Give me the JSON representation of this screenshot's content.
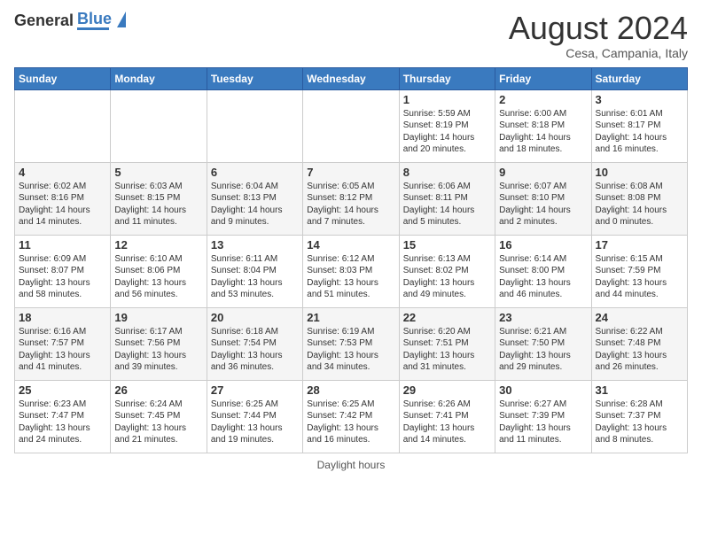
{
  "logo": {
    "general": "General",
    "blue": "Blue"
  },
  "title": "August 2024",
  "subtitle": "Cesa, Campania, Italy",
  "days_header": [
    "Sunday",
    "Monday",
    "Tuesday",
    "Wednesday",
    "Thursday",
    "Friday",
    "Saturday"
  ],
  "weeks": [
    [
      {
        "day": "",
        "info": ""
      },
      {
        "day": "",
        "info": ""
      },
      {
        "day": "",
        "info": ""
      },
      {
        "day": "",
        "info": ""
      },
      {
        "day": "1",
        "info": "Sunrise: 5:59 AM\nSunset: 8:19 PM\nDaylight: 14 hours\nand 20 minutes."
      },
      {
        "day": "2",
        "info": "Sunrise: 6:00 AM\nSunset: 8:18 PM\nDaylight: 14 hours\nand 18 minutes."
      },
      {
        "day": "3",
        "info": "Sunrise: 6:01 AM\nSunset: 8:17 PM\nDaylight: 14 hours\nand 16 minutes."
      }
    ],
    [
      {
        "day": "4",
        "info": "Sunrise: 6:02 AM\nSunset: 8:16 PM\nDaylight: 14 hours\nand 14 minutes."
      },
      {
        "day": "5",
        "info": "Sunrise: 6:03 AM\nSunset: 8:15 PM\nDaylight: 14 hours\nand 11 minutes."
      },
      {
        "day": "6",
        "info": "Sunrise: 6:04 AM\nSunset: 8:13 PM\nDaylight: 14 hours\nand 9 minutes."
      },
      {
        "day": "7",
        "info": "Sunrise: 6:05 AM\nSunset: 8:12 PM\nDaylight: 14 hours\nand 7 minutes."
      },
      {
        "day": "8",
        "info": "Sunrise: 6:06 AM\nSunset: 8:11 PM\nDaylight: 14 hours\nand 5 minutes."
      },
      {
        "day": "9",
        "info": "Sunrise: 6:07 AM\nSunset: 8:10 PM\nDaylight: 14 hours\nand 2 minutes."
      },
      {
        "day": "10",
        "info": "Sunrise: 6:08 AM\nSunset: 8:08 PM\nDaylight: 14 hours\nand 0 minutes."
      }
    ],
    [
      {
        "day": "11",
        "info": "Sunrise: 6:09 AM\nSunset: 8:07 PM\nDaylight: 13 hours\nand 58 minutes."
      },
      {
        "day": "12",
        "info": "Sunrise: 6:10 AM\nSunset: 8:06 PM\nDaylight: 13 hours\nand 56 minutes."
      },
      {
        "day": "13",
        "info": "Sunrise: 6:11 AM\nSunset: 8:04 PM\nDaylight: 13 hours\nand 53 minutes."
      },
      {
        "day": "14",
        "info": "Sunrise: 6:12 AM\nSunset: 8:03 PM\nDaylight: 13 hours\nand 51 minutes."
      },
      {
        "day": "15",
        "info": "Sunrise: 6:13 AM\nSunset: 8:02 PM\nDaylight: 13 hours\nand 49 minutes."
      },
      {
        "day": "16",
        "info": "Sunrise: 6:14 AM\nSunset: 8:00 PM\nDaylight: 13 hours\nand 46 minutes."
      },
      {
        "day": "17",
        "info": "Sunrise: 6:15 AM\nSunset: 7:59 PM\nDaylight: 13 hours\nand 44 minutes."
      }
    ],
    [
      {
        "day": "18",
        "info": "Sunrise: 6:16 AM\nSunset: 7:57 PM\nDaylight: 13 hours\nand 41 minutes."
      },
      {
        "day": "19",
        "info": "Sunrise: 6:17 AM\nSunset: 7:56 PM\nDaylight: 13 hours\nand 39 minutes."
      },
      {
        "day": "20",
        "info": "Sunrise: 6:18 AM\nSunset: 7:54 PM\nDaylight: 13 hours\nand 36 minutes."
      },
      {
        "day": "21",
        "info": "Sunrise: 6:19 AM\nSunset: 7:53 PM\nDaylight: 13 hours\nand 34 minutes."
      },
      {
        "day": "22",
        "info": "Sunrise: 6:20 AM\nSunset: 7:51 PM\nDaylight: 13 hours\nand 31 minutes."
      },
      {
        "day": "23",
        "info": "Sunrise: 6:21 AM\nSunset: 7:50 PM\nDaylight: 13 hours\nand 29 minutes."
      },
      {
        "day": "24",
        "info": "Sunrise: 6:22 AM\nSunset: 7:48 PM\nDaylight: 13 hours\nand 26 minutes."
      }
    ],
    [
      {
        "day": "25",
        "info": "Sunrise: 6:23 AM\nSunset: 7:47 PM\nDaylight: 13 hours\nand 24 minutes."
      },
      {
        "day": "26",
        "info": "Sunrise: 6:24 AM\nSunset: 7:45 PM\nDaylight: 13 hours\nand 21 minutes."
      },
      {
        "day": "27",
        "info": "Sunrise: 6:25 AM\nSunset: 7:44 PM\nDaylight: 13 hours\nand 19 minutes."
      },
      {
        "day": "28",
        "info": "Sunrise: 6:25 AM\nSunset: 7:42 PM\nDaylight: 13 hours\nand 16 minutes."
      },
      {
        "day": "29",
        "info": "Sunrise: 6:26 AM\nSunset: 7:41 PM\nDaylight: 13 hours\nand 14 minutes."
      },
      {
        "day": "30",
        "info": "Sunrise: 6:27 AM\nSunset: 7:39 PM\nDaylight: 13 hours\nand 11 minutes."
      },
      {
        "day": "31",
        "info": "Sunrise: 6:28 AM\nSunset: 7:37 PM\nDaylight: 13 hours\nand 8 minutes."
      }
    ]
  ],
  "footer": {
    "daylight_label": "Daylight hours"
  }
}
